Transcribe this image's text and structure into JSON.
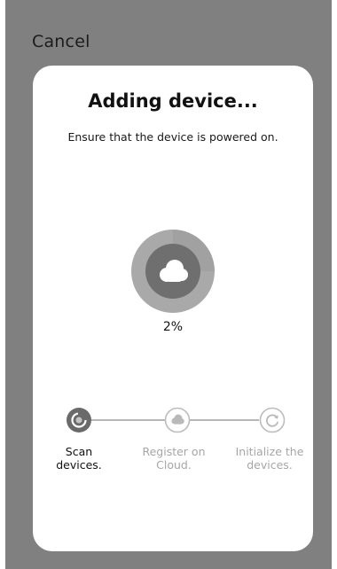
{
  "header": {
    "cancel_label": "Cancel"
  },
  "dialog": {
    "title": "Adding device...",
    "subtitle": "Ensure that the device is powered on.",
    "progress_text": "2%",
    "progress_value": 0.02,
    "center_icon": "cloud-icon"
  },
  "steps": [
    {
      "line1": "Scan",
      "line2": "devices.",
      "icon": "scan-progress-icon",
      "state": "active"
    },
    {
      "line1": "Register on",
      "line2": "Cloud.",
      "icon": "cloud-icon",
      "state": "pending"
    },
    {
      "line1": "Initialize the",
      "line2": "devices.",
      "icon": "refresh-icon",
      "state": "pending"
    }
  ],
  "colors": {
    "overlay": "#808080",
    "card": "#ffffff",
    "ring_outer": "#9c9c9c",
    "ring_inner": "#6f6f6f",
    "step_active": "#6a6a6a",
    "step_inactive": "#b9b9b9"
  }
}
